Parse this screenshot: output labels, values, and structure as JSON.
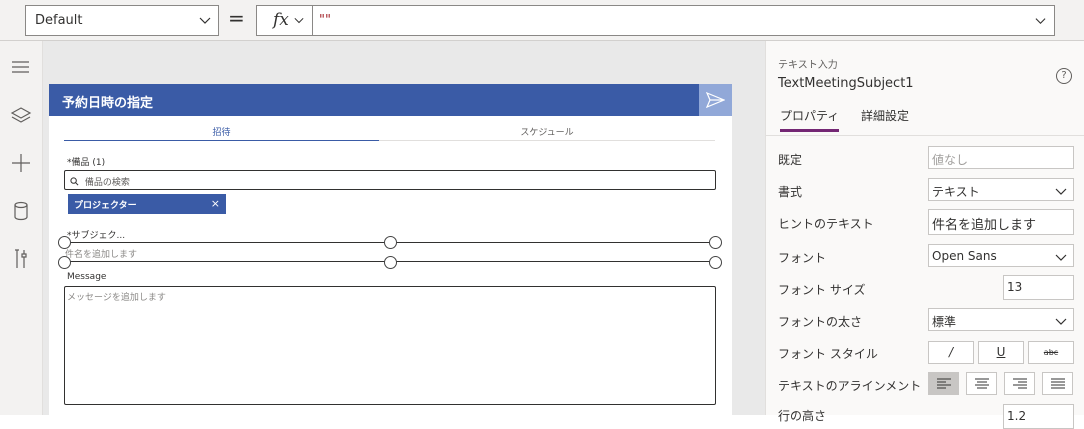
{
  "formula_bar": {
    "property": "Default",
    "equals": "=",
    "fx": "fx",
    "formula": "\"\""
  },
  "left_rail": {
    "icons": [
      "hamburger-icon",
      "layers-icon",
      "plus-icon",
      "database-icon",
      "tools-icon"
    ]
  },
  "app": {
    "header_title": "予約日時の指定",
    "tabs": [
      "招待",
      "スケジュール"
    ],
    "equipment_label": "*備品 (1)",
    "search_placeholder": "備品の検索",
    "chip_label": "プロジェクター",
    "chip_close": "×",
    "subject_label": "*サブジェク...",
    "subject_placeholder": "件名を追加します",
    "message_label": "Message",
    "message_placeholder": "メッセージを追加します"
  },
  "properties_pane": {
    "control_type": "テキスト入力",
    "control_name": "TextMeetingSubject1",
    "help_icon": "?",
    "tabs": [
      "プロパティ",
      "詳細設定"
    ],
    "rows": [
      {
        "label": "既定",
        "value": "値なし",
        "kind": "placeholder"
      },
      {
        "label": "書式",
        "value": "テキスト",
        "kind": "dropdown"
      },
      {
        "label": "ヒントのテキスト",
        "value": "件名を追加します",
        "kind": "text"
      },
      {
        "label": "フォント",
        "value": "Open Sans",
        "kind": "dropdown"
      },
      {
        "label": "フォント サイズ",
        "value": "13",
        "kind": "number"
      },
      {
        "label": "フォントの太さ",
        "value": "標準",
        "kind": "dropdown"
      },
      {
        "label": "フォント スタイル",
        "value": "",
        "kind": "style"
      },
      {
        "label": "テキストのアラインメント",
        "value": "",
        "kind": "align"
      },
      {
        "label": "行の高さ",
        "value": "1.2",
        "kind": "number"
      }
    ],
    "font_style_buttons": [
      "/",
      "U",
      "abc"
    ]
  },
  "colors": {
    "header_blue": "#3a5ba6",
    "send_blue": "#91a8d8",
    "accent_purple": "#742774"
  }
}
